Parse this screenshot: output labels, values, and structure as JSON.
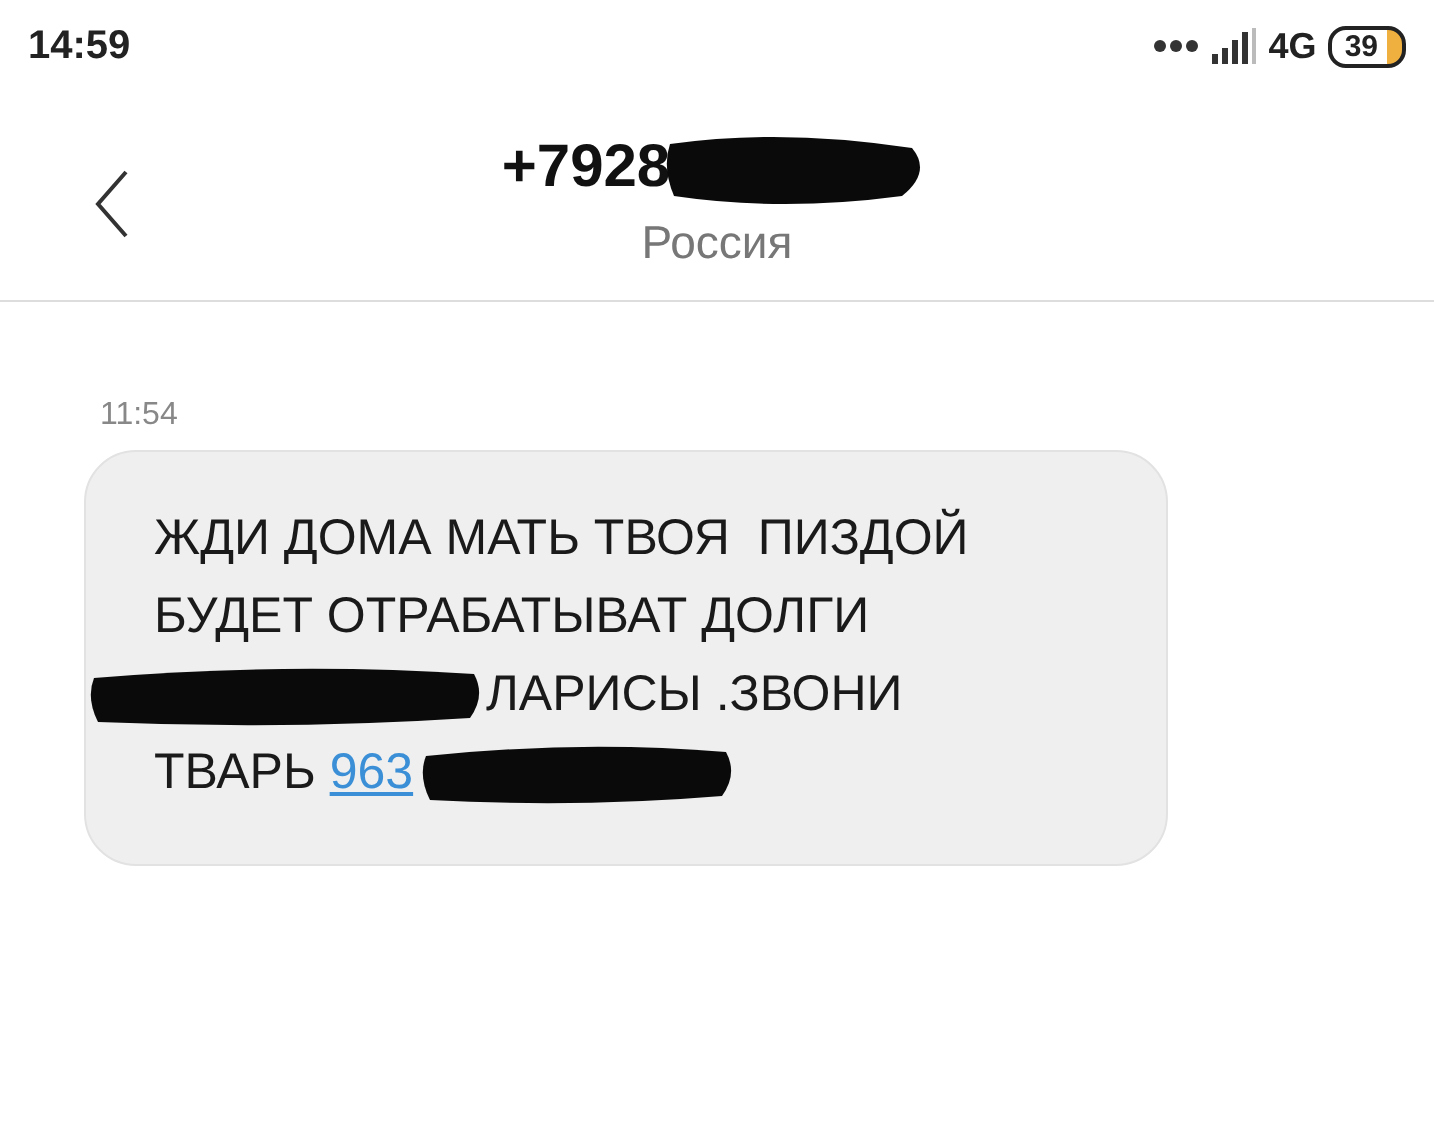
{
  "status_bar": {
    "time": "14:59",
    "network": "4G",
    "battery": "39"
  },
  "header": {
    "phone": "+7928",
    "country": "Россия"
  },
  "messages": [
    {
      "time": "11:54",
      "lines": [
        {
          "parts": [
            {
              "kind": "text",
              "text": "ЖДИ ДОМА МАТЬ ТВОЯ  ПИЗДОЙ"
            }
          ]
        },
        {
          "parts": [
            {
              "kind": "text",
              "text": "БУДЕТ ОТРАБАТЫВАТ ДОЛГИ"
            }
          ]
        },
        {
          "parts": [
            {
              "kind": "redacted"
            },
            {
              "kind": "text",
              "text": "ЛАРИСЫ .ЗВОНИ"
            }
          ]
        },
        {
          "parts": [
            {
              "kind": "text",
              "text": "ТВАРЬ "
            },
            {
              "kind": "link",
              "text": "963"
            },
            {
              "kind": "redacted"
            }
          ]
        }
      ]
    }
  ]
}
